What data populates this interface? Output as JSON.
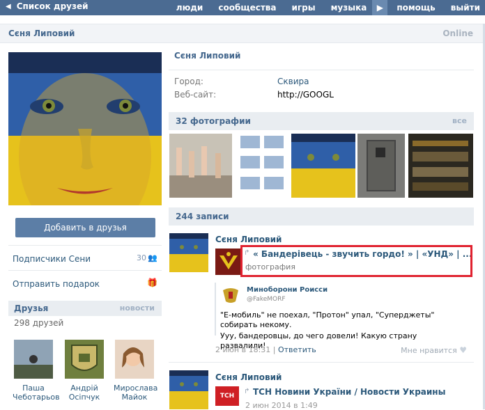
{
  "topbar": {
    "back_label": "Список друзей",
    "nav": [
      "люди",
      "сообщества",
      "игры",
      "музыка",
      "помощь",
      "выйти"
    ]
  },
  "profile": {
    "name": "Сєня Липовий",
    "status": "Online",
    "city_label": "Город:",
    "city_value": "Сквира",
    "website_label": "Веб-сайт:",
    "website_value": "http://GOOGL"
  },
  "sidebar": {
    "add_friend": "Добавить в друзья",
    "subscribers_label": "Подписчики Сени",
    "subscribers_count": "30",
    "gift_label": "Отправить подарок",
    "friends_title": "Друзья",
    "friends_news": "новости",
    "friends_count": "298 друзей",
    "friends": [
      {
        "first": "Паша",
        "last": "Чеботарьов"
      },
      {
        "first": "Андрій",
        "last": "Осіпчук"
      },
      {
        "first": "Мирослава",
        "last": "Майок"
      }
    ]
  },
  "photos": {
    "title": "32 фотографии",
    "all": "все"
  },
  "wall": {
    "title": "244 записи",
    "post1": {
      "author": "Сєня Липовий",
      "share_title": "« Бандерівець - звучить гордо! » | «УНД» | ...",
      "share_sub": "фотография",
      "repost_name": "Миноборони Роисси",
      "repost_handle": "@FakeMORF",
      "repost_text_1": "\"Е-мобиль\" не поехал, \"Протон\" упал, \"Суперджеты\" собирать некому.",
      "repost_text_2": "Ууу, бандеровцы, до чего довели! Какую страну развалили!",
      "date": "2 июн в 18:31",
      "divider": " | ",
      "reply": "Ответить",
      "like": "Мне нравится"
    },
    "post2": {
      "author": "Сєня Липовий",
      "badge": "ТСН",
      "share_title": "ТСН Новини України / Новости Украины",
      "date": "2 июн 2014 в 1:49"
    }
  },
  "colors": {
    "topbar": "#4b6b92",
    "link": "#2b587a",
    "highlight": "#e0222f"
  }
}
